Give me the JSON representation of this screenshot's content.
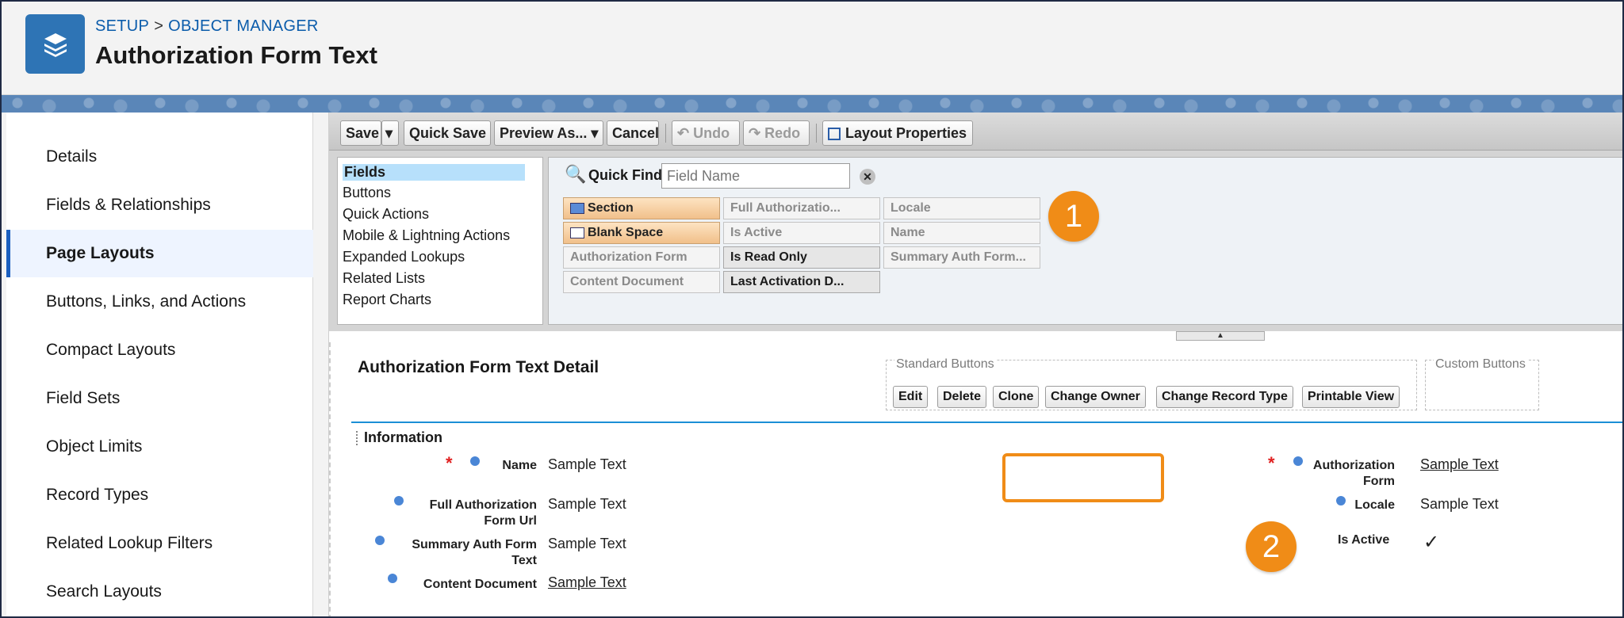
{
  "header": {
    "breadcrumb_setup": "SETUP",
    "breadcrumb_sep": ">",
    "breadcrumb_object_manager": "OBJECT MANAGER",
    "title": "Authorization Form Text",
    "icon": "layers-icon"
  },
  "sidebar": {
    "items": [
      {
        "label": "Details"
      },
      {
        "label": "Fields & Relationships"
      },
      {
        "label": "Page Layouts"
      },
      {
        "label": "Buttons, Links, and Actions"
      },
      {
        "label": "Compact Layouts"
      },
      {
        "label": "Field Sets"
      },
      {
        "label": "Object Limits"
      },
      {
        "label": "Record Types"
      },
      {
        "label": "Related Lookup Filters"
      },
      {
        "label": "Search Layouts"
      }
    ],
    "active": "Page Layouts"
  },
  "toolbar": {
    "save": "Save",
    "quick_save": "Quick Save",
    "preview_as": "Preview As...",
    "cancel": "Cancel",
    "undo": "Undo",
    "redo": "Redo",
    "layout_properties": "Layout Properties"
  },
  "palette": {
    "categories": [
      "Fields",
      "Buttons",
      "Quick Actions",
      "Mobile & Lightning Actions",
      "Expanded Lookups",
      "Related Lists",
      "Report Charts"
    ],
    "quick_find_label": "Quick Find",
    "quick_find_placeholder": "Field Name",
    "fields": [
      "Section",
      "Full Authorizatio...",
      "Locale",
      "Blank Space",
      "Is Active",
      "Name",
      "Authorization Form",
      "Is Read Only",
      "Summary Auth Form...",
      "Content Document",
      "Last Activation D..."
    ]
  },
  "callouts": [
    "1",
    "2"
  ],
  "detail": {
    "title": "Authorization Form Text Detail",
    "standard_buttons_label": "Standard Buttons",
    "custom_buttons_label": "Custom Buttons",
    "buttons": [
      "Edit",
      "Delete",
      "Clone",
      "Change Owner",
      "Change Record Type",
      "Printable View"
    ],
    "section": "Information",
    "left_fields": [
      {
        "label": "Name",
        "value": "Sample Text"
      },
      {
        "label": "Full Authorization Form Url",
        "value": "Sample Text"
      },
      {
        "label": "Summary Auth Form Text",
        "value": "Sample Text"
      },
      {
        "label": "Content Document",
        "value": "Sample Text"
      }
    ],
    "right_fields": [
      {
        "label": "Authorization Form",
        "value": "Sample Text"
      },
      {
        "label": "Locale",
        "value": "Sample Text"
      },
      {
        "label": "Is Active",
        "value": "✓"
      }
    ],
    "required_mark": "*"
  },
  "colors": {
    "brand": "#2e74b5",
    "link": "#0b5cab",
    "callout": "#f08c17",
    "section_line": "#1b8fd6"
  }
}
